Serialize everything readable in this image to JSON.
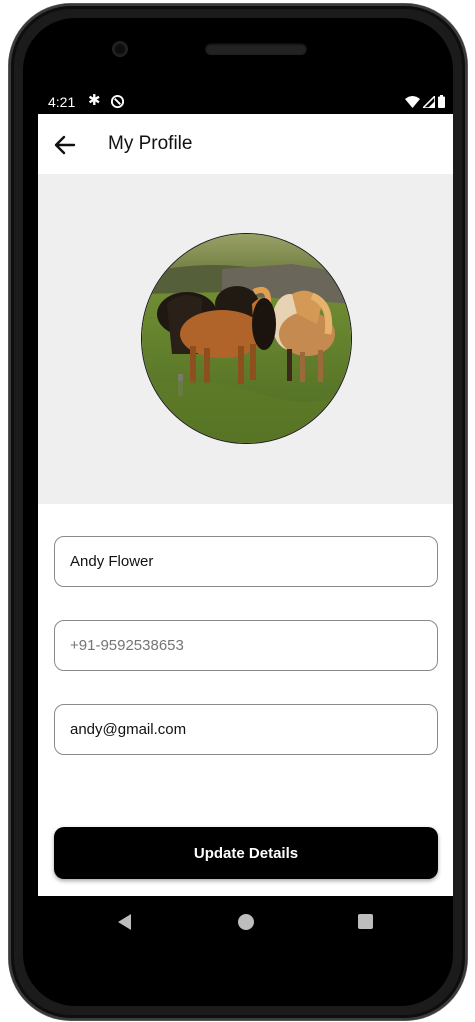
{
  "status_bar": {
    "time": "4:21",
    "icons": [
      "settings-icon",
      "sync-icon",
      "wifi-icon",
      "signal-icon",
      "battery-icon"
    ]
  },
  "app_bar": {
    "title": "My Profile",
    "back_icon": "arrow-left-icon"
  },
  "profile": {
    "avatar_alt": "horses-photo",
    "name_value": "Andy Flower",
    "phone_placeholder": "+91-9592538653",
    "phone_value": "",
    "email_value": "andy@gmail.com"
  },
  "actions": {
    "update_label": "Update Details"
  },
  "nav_bar": {
    "icons": [
      "nav-back-icon",
      "nav-home-icon",
      "nav-recents-icon"
    ]
  },
  "colors": {
    "header_bg": "#efefef",
    "button_bg": "#000000",
    "button_text": "#ffffff",
    "field_border": "#8a8a8a"
  }
}
